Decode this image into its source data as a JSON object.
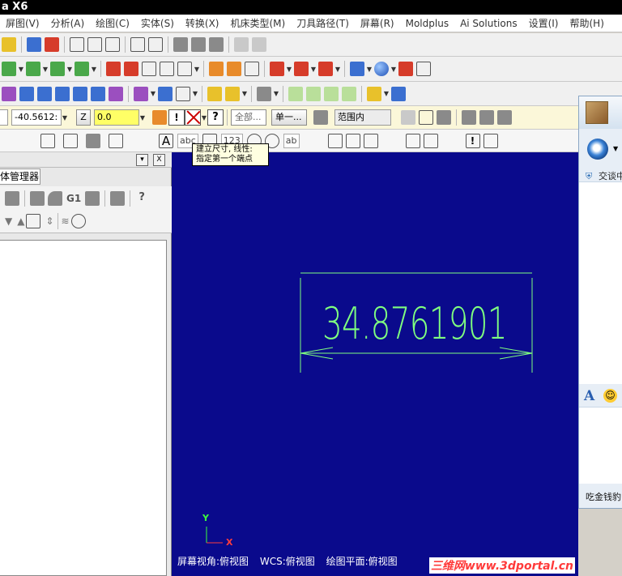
{
  "window": {
    "title": "a X6"
  },
  "menu": [
    "屏图(V)",
    "分析(A)",
    "绘图(C)",
    "实体(S)",
    "转换(X)",
    "机床类型(M)",
    "刀具路径(T)",
    "屏幕(R)",
    "Moldplus",
    "Ai Solutions",
    "设置(I)",
    "帮助(H)"
  ],
  "dimbar": {
    "coord_value": "-40.5612:",
    "z_label": "Z",
    "z_value": "0.0",
    "select_all": "全部...",
    "select_single": "单一...",
    "range_option": "范围内"
  },
  "tooltip": {
    "line1": "建立尺寸, 线性:",
    "line2": "指定第一个端点"
  },
  "icon_labels": {
    "abc": "abc",
    "n123": "123",
    "ab": "ab"
  },
  "left_panel": {
    "tab_label": "体管理器",
    "min_btn": "▾",
    "close_btn": "X",
    "g1_label": "G1"
  },
  "canvas": {
    "dimension_value": "34.8761901",
    "axis_y": "Y",
    "axis_x": "X",
    "status": {
      "screen_view": "屏幕视角:俯视图",
      "wcs": "WCS:俯视图",
      "drawing_plane": "绘图平面:俯视图"
    },
    "watermark": "三维网www.3dportal.cn"
  },
  "right_panel": {
    "chat_label": "交谈中",
    "footer": "吃金钱豹"
  },
  "colors": {
    "canvas_bg": "#0a0a8c",
    "geometry": "#7fff7f",
    "axis_y": "#3cff3c",
    "axis_x": "#ff3c3c",
    "coord_field_bg": "#ffff66"
  }
}
